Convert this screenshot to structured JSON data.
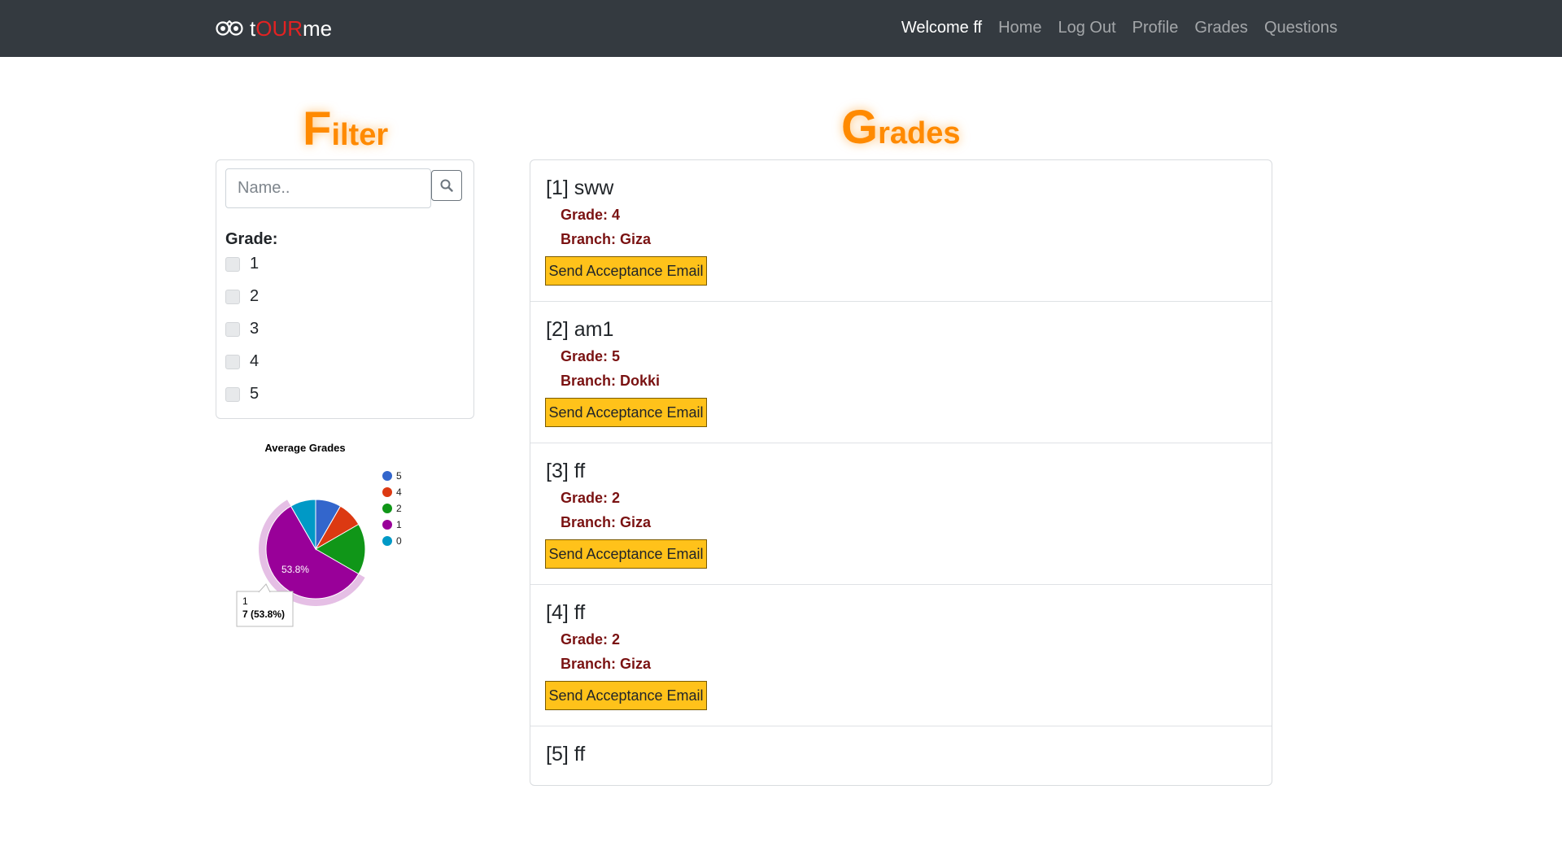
{
  "nav": {
    "brand_pre": "t",
    "brand_red": "OUR",
    "brand_post": "me",
    "links": [
      "Welcome ff",
      "Home",
      "Log Out",
      "Profile",
      "Grades",
      "Questions"
    ]
  },
  "filter": {
    "heading_initial": "F",
    "heading_rest": "ilter",
    "search_placeholder": "Name..",
    "grade_label": "Grade:",
    "grades": [
      "1",
      "2",
      "3",
      "4",
      "5"
    ]
  },
  "grades": {
    "heading_initial": "G",
    "heading_rest": "rades",
    "button_label": "Send Acceptance Email",
    "items": [
      {
        "title": "[1] sww",
        "grade": "Grade: 4",
        "branch": "Branch: Giza"
      },
      {
        "title": "[2] am1",
        "grade": "Grade: 5",
        "branch": "Branch: Dokki"
      },
      {
        "title": "[3] ff",
        "grade": "Grade: 2",
        "branch": "Branch: Giza"
      },
      {
        "title": "[4] ff",
        "grade": "Grade: 2",
        "branch": "Branch: Giza"
      },
      {
        "title": "[5] ff",
        "grade": "",
        "branch": ""
      }
    ]
  },
  "chart_data": {
    "type": "pie",
    "title": "Average Grades",
    "legend_position": "right",
    "slices": [
      {
        "label": "5",
        "value": 1,
        "color": "#3366cc"
      },
      {
        "label": "4",
        "value": 1,
        "color": "#dc3912"
      },
      {
        "label": "2",
        "value": 2,
        "color": "#109618"
      },
      {
        "label": "1",
        "value": 7,
        "color": "#990099"
      },
      {
        "label": "0",
        "value": 1,
        "color": "#0099c6"
      }
    ],
    "highlighted": {
      "label": "1",
      "slice_text": "53.8%",
      "tooltip_value": "7 (53.8%)"
    }
  }
}
